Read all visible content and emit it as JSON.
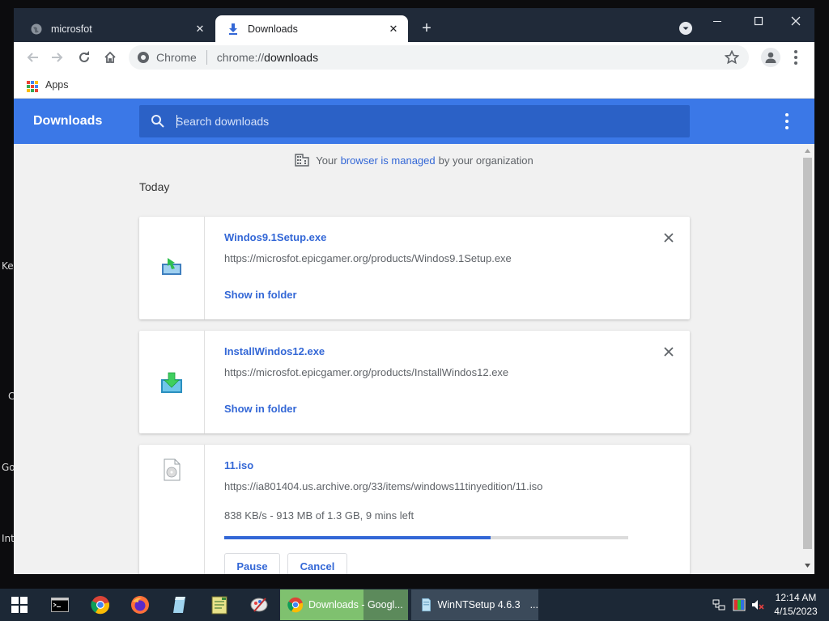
{
  "desktop": {
    "labels": [
      "Ke",
      "C",
      "Go",
      "Int"
    ]
  },
  "browser": {
    "tabs": [
      {
        "title": "microsfot",
        "icon": "globe-icon",
        "active": false
      },
      {
        "title": "Downloads",
        "icon": "download-icon",
        "active": true
      }
    ],
    "omnibox": {
      "site_label": "Chrome",
      "url_scheme": "chrome://",
      "url_host": "downloads"
    },
    "bookmarks": {
      "apps_label": "Apps"
    }
  },
  "downloads_page": {
    "title": "Downloads",
    "search_placeholder": "Search downloads",
    "managed_notice": {
      "prefix": "Your",
      "link": "browser is managed",
      "suffix": "by your organization"
    },
    "section_label": "Today",
    "items": [
      {
        "name": "Windos9.1Setup.exe",
        "url": "https://microsfot.epicgamer.org/products/Windos9.1Setup.exe",
        "action_link": "Show in folder",
        "icon": "installer-icon"
      },
      {
        "name": "InstallWindos12.exe",
        "url": "https://microsfot.epicgamer.org/products/InstallWindos12.exe",
        "action_link": "Show in folder",
        "icon": "download-installer-icon"
      },
      {
        "name": "11.iso",
        "url": "https://ia801404.us.archive.org/33/items/windows11tinyedition/11.iso",
        "status": "838 KB/s - 913 MB of 1.3 GB, 9 mins left",
        "progress_fraction": 0.66,
        "pause_label": "Pause",
        "cancel_label": "Cancel",
        "icon": "disc-file-icon"
      }
    ]
  },
  "taskbar": {
    "apps": [
      {
        "label": "Downloads - Googl...",
        "icon": "chrome-icon"
      },
      {
        "label": "WinNTSetup 4.6.3",
        "suffix": "...",
        "icon": "winntsetup-icon"
      }
    ],
    "clock": {
      "time": "12:14 AM",
      "date": "4/15/2023"
    }
  },
  "colors": {
    "accent": "#3b78e7",
    "link": "#3367d6",
    "titlebar": "#202a39",
    "taskbar": "#1c2836"
  }
}
